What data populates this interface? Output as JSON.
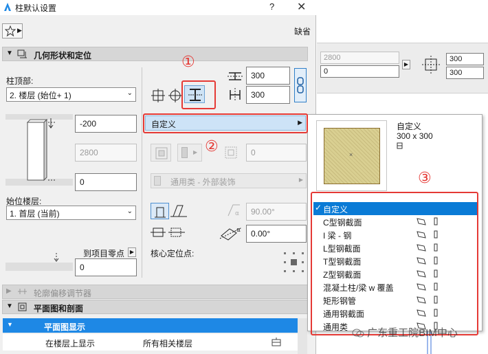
{
  "window": {
    "title": "柱默认设置",
    "help": "?",
    "close": "✕"
  },
  "toolbar": {
    "default_label": "缺省"
  },
  "sections": {
    "geometry": "几何形状和定位",
    "profile_offset": "轮廓偏移调节器",
    "plan_section": "平面图和剖面"
  },
  "geometry": {
    "top_label": "柱顶部:",
    "top_value": "2. 楼层 (始位+ 1)",
    "top_offset": "-200",
    "height": "2800",
    "bottom_offset": "0",
    "base_label": "始位楼层:",
    "base_value": "1. 首层 (当前)",
    "to_project_zero": "到项目零点",
    "project_zero_value": "0",
    "width": "300",
    "depth": "300",
    "profile_selected": "自定义",
    "disabled_value": "0",
    "surface_label": "通用类 - 外部装饰",
    "angle_value": "90.00°",
    "rotation_value": "0.00°",
    "core_anchor_label": "核心定位点:"
  },
  "popup": {
    "preview_name": "自定义",
    "preview_size": "300 x 300",
    "preview_marker": "×",
    "items": [
      {
        "label": "自定义",
        "selected": true
      },
      {
        "label": "C型钢截面",
        "selected": false
      },
      {
        "label": "I 梁 - 钢",
        "selected": false
      },
      {
        "label": "L型钢截面",
        "selected": false
      },
      {
        "label": "T型钢截面",
        "selected": false
      },
      {
        "label": "Z型钢截面",
        "selected": false
      },
      {
        "label": "混凝土柱/梁 w 覆盖",
        "selected": false
      },
      {
        "label": "矩形钢管",
        "selected": false
      },
      {
        "label": "通用钢截面",
        "selected": false
      },
      {
        "label": "通用类",
        "selected": false
      }
    ]
  },
  "annotations": {
    "n1": "①",
    "n2": "②",
    "n3": "③",
    "color": "#e53935"
  },
  "plan": {
    "row_header": "平面图显示",
    "row_label": "在楼层上显示",
    "row_value": "所有相关楼层"
  },
  "background": {
    "field_a": "2800",
    "field_b": "0",
    "field_c": "300",
    "field_d": "300"
  },
  "watermark": "广东重工院BIM中心",
  "colors": {
    "selection": "#0a7bd6",
    "accent_blue": "#1e88e5",
    "highlight_row": "#cde3f7"
  }
}
